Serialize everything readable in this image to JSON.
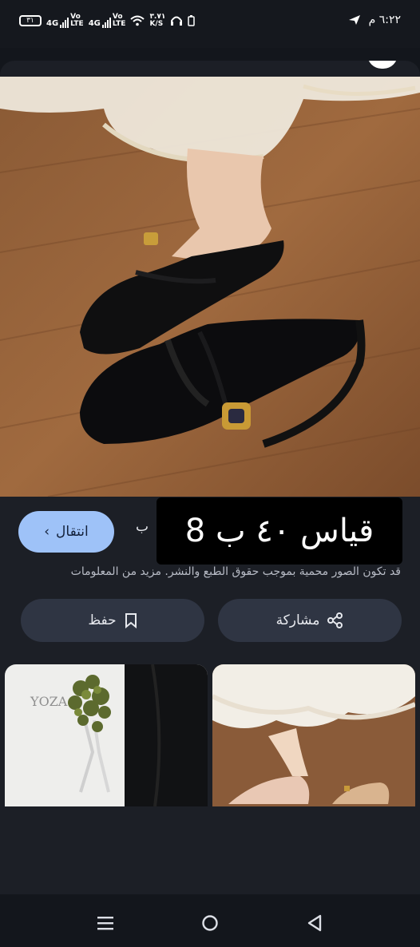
{
  "status_bar": {
    "battery": "٣١",
    "net1": "4G",
    "volte1_a": "Vo",
    "volte1_b": "LTE",
    "net2": "4G",
    "volte2_a": "Vo",
    "volte2_b": "LTE",
    "speed_value": "٣.٧١",
    "speed_unit": "K/S",
    "time": "٦:٢٢ م"
  },
  "actions": {
    "visit_label": "انتقال",
    "save_label": "حفظ",
    "share_label": "مشاركة"
  },
  "result": {
    "title_fragment": "ب",
    "copyright_note": "قد تكون الصور محمية بموجب حقوق الطبع والنشر. مزيد من المعلومات"
  },
  "overlay_text": "قياس ٤٠ ب 8",
  "related": [
    {
      "brand_text": "YOZA"
    },
    {
      "brand_text": ""
    }
  ]
}
